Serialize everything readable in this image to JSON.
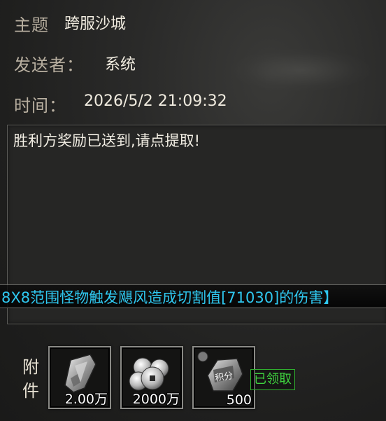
{
  "mail": {
    "subject_label": "主题",
    "subject_value": "跨服沙城",
    "sender_label": "发送者：",
    "sender_value": "系统",
    "time_label": "时间：",
    "time_value": "2026/5/2 21:09:32",
    "message": "胜利方奖励已送到,请点提取!"
  },
  "broadcast": {
    "text": "8X8范围怪物触发飓风造成切割值[71030]的伤害】",
    "color": "#2fc8f0"
  },
  "attachments": {
    "label": "附件",
    "items": [
      {
        "icon": "silver-ingot-icon",
        "count": "2.00万"
      },
      {
        "icon": "coins-stack-icon",
        "count": "2000万"
      },
      {
        "icon": "points-badge-icon",
        "count": "500"
      }
    ],
    "status": "已领取",
    "status_color": "#3fd23f"
  }
}
